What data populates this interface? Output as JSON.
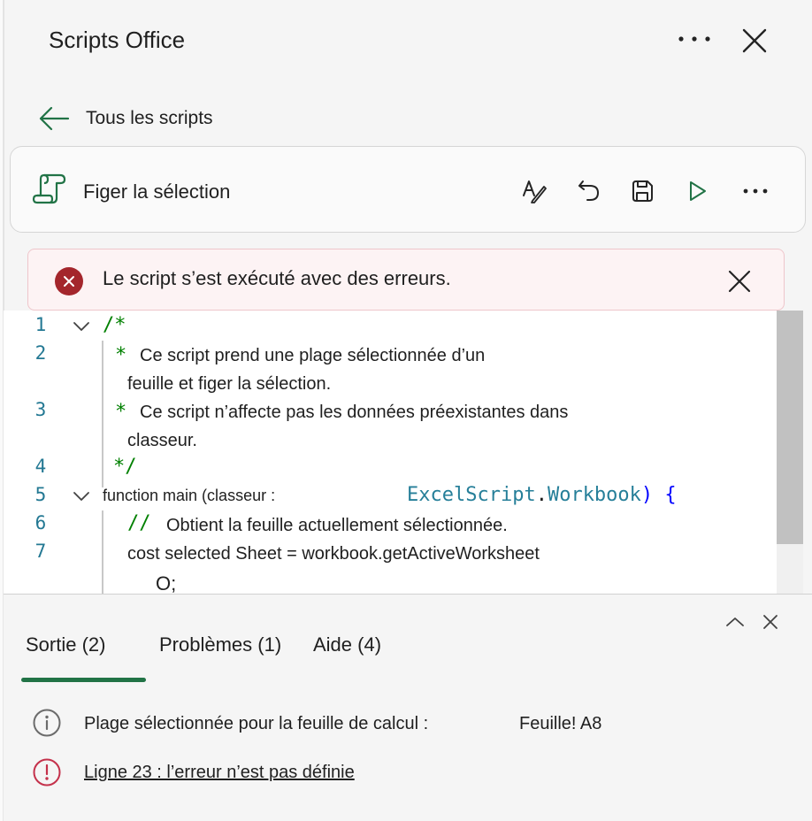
{
  "header": {
    "title": "Scripts Office",
    "more_icon": "more-horizontal-icon",
    "close_icon": "close-icon"
  },
  "nav": {
    "back_label": "Tous les scripts",
    "back_icon": "arrow-left-icon",
    "accent_color": "#217346"
  },
  "script": {
    "name": "Figer la sélection",
    "icon": "script-scroll-icon",
    "toolbar": [
      "spell-check-icon",
      "undo-icon",
      "save-icon",
      "run-icon",
      "more-horizontal-icon"
    ]
  },
  "error": {
    "message": "Le script s’est exécuté avec des erreurs.",
    "icon": "error-circle-icon",
    "color": "#a4262c",
    "close_icon": "close-icon"
  },
  "editor": {
    "line_numbers": [
      "1",
      "2",
      "3",
      "4",
      "5",
      "6",
      "7"
    ],
    "lines": {
      "l1": "/*",
      "l2_star": "*",
      "l2a": "Ce script prend une plage sélectionnée d’un",
      "l2b": "feuille et figer la sélection.",
      "l3_star": "*",
      "l3a": "Ce script n’affecte pas les données préexistantes dans",
      "l3b": "classeur.",
      "l4": "*/",
      "l5_kw": "function main (classeur :",
      "l5_type1": "ExcelScript",
      "l5_dot": ".",
      "l5_type2": "Workbook",
      "l5_paren": ")",
      "l5_brace": "{",
      "l6_slash": "//",
      "l6_comment": "Obtient la feuille actuellement sélectionnée.",
      "l7a": "cost selected Sheet = workbook.getActiveWorksheet",
      "l7b": "O;"
    }
  },
  "output_panel": {
    "tabs": [
      {
        "label": "Sortie (2)",
        "active": true
      },
      {
        "label": "Problèmes (1)",
        "active": false
      },
      {
        "label": "Aide (4)",
        "active": false
      }
    ],
    "rows": [
      {
        "icon": "info-icon",
        "text": "Plage sélectionnée pour la feuille de calcul :",
        "value": "Feuille! A8"
      },
      {
        "icon": "error-outline-icon",
        "text": "Ligne 23 : l’erreur n’est pas définie"
      }
    ]
  }
}
